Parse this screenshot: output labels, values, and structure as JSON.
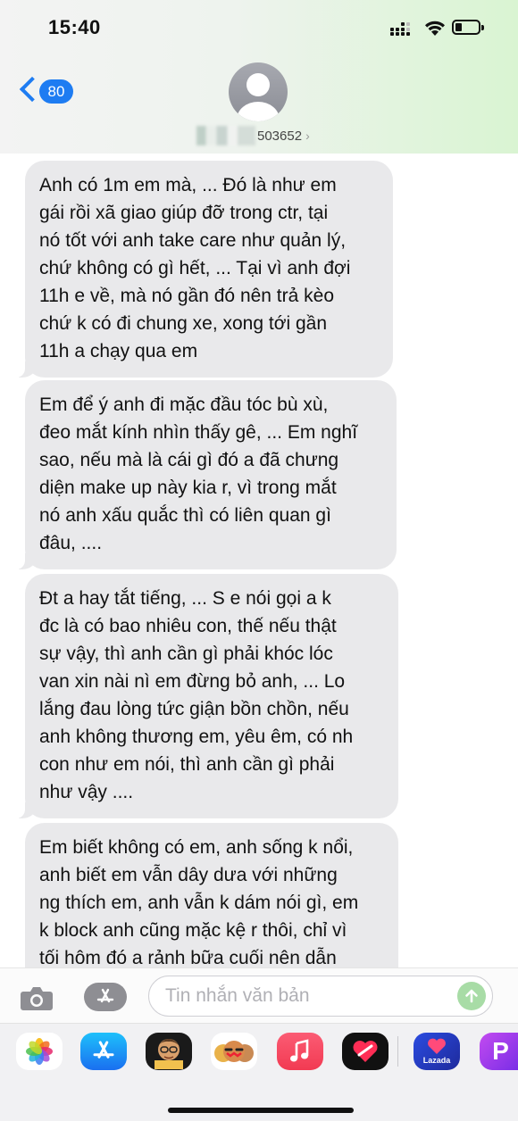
{
  "status_bar": {
    "time": "15:40"
  },
  "header": {
    "back_count": "80",
    "contact_suffix": "503652",
    "contact_chevron": "›"
  },
  "messages": [
    {
      "lines": [
        "Anh có 1m em mà, ... Đó là như em",
        "gái rồi xã giao giúp đỡ trong ctr, tại",
        "nó tốt với anh take care như quản lý,",
        "chứ không có gì hết, ... Tại vì anh đợi",
        "11h e về, mà nó gần đó nên trả kèo",
        "chứ k có đi chung xe, xong tới gần",
        "11h a chạy qua em"
      ]
    },
    {
      "lines": [
        "Em để ý anh đi mặc đầu tóc bù xù,",
        "đeo mắt kính nhìn thấy gê, ... Em nghĩ",
        "sao, nếu mà là cái gì đó a đã chưng",
        "diện make up này kia r, vì trong mắt",
        "nó anh xấu quắc thì có liên quan gì",
        "đâu, ...."
      ]
    },
    {
      "lines": [
        "Đt a hay tắt tiếng, ... S e nói gọi a k",
        "đc là có bao nhiêu con, thế nếu thật",
        "sự vậy, thì anh cần gì phải khóc lóc",
        "van xin nài nì em đừng bỏ anh, ... Lo",
        "lắng đau lòng tức giận bồn chồn, nếu",
        "anh không thương em, yêu êm, có nh",
        "con như em nói, thì anh cần gì phải",
        "như vậy ...."
      ]
    },
    {
      "lines": [
        "Em biết không có em, anh sống k nổi,",
        "anh biết em vẫn dây dưa với những",
        "ng thích em, anh vẫn k dám nói gì, em",
        "k block anh cũng mặc kệ r thôi, chỉ vì",
        "tối hôm đó a rảnh bữa cuối nên dẫn"
      ]
    }
  ],
  "compose": {
    "placeholder": "Tin nhắn văn bản"
  },
  "app_drawer": {
    "apps": [
      "photos-icon",
      "app-store-icon",
      "memoji-icon",
      "animoji-icon",
      "music-icon",
      "digital-touch-icon",
      "lazada-icon",
      "picsart-icon"
    ],
    "lazada_label": "Lazada",
    "picsart_letter": "P"
  },
  "colors": {
    "accent_blue": "#1e7cf2",
    "bubble_gray": "#e9e9eb",
    "send_green": "#a8dca6"
  }
}
